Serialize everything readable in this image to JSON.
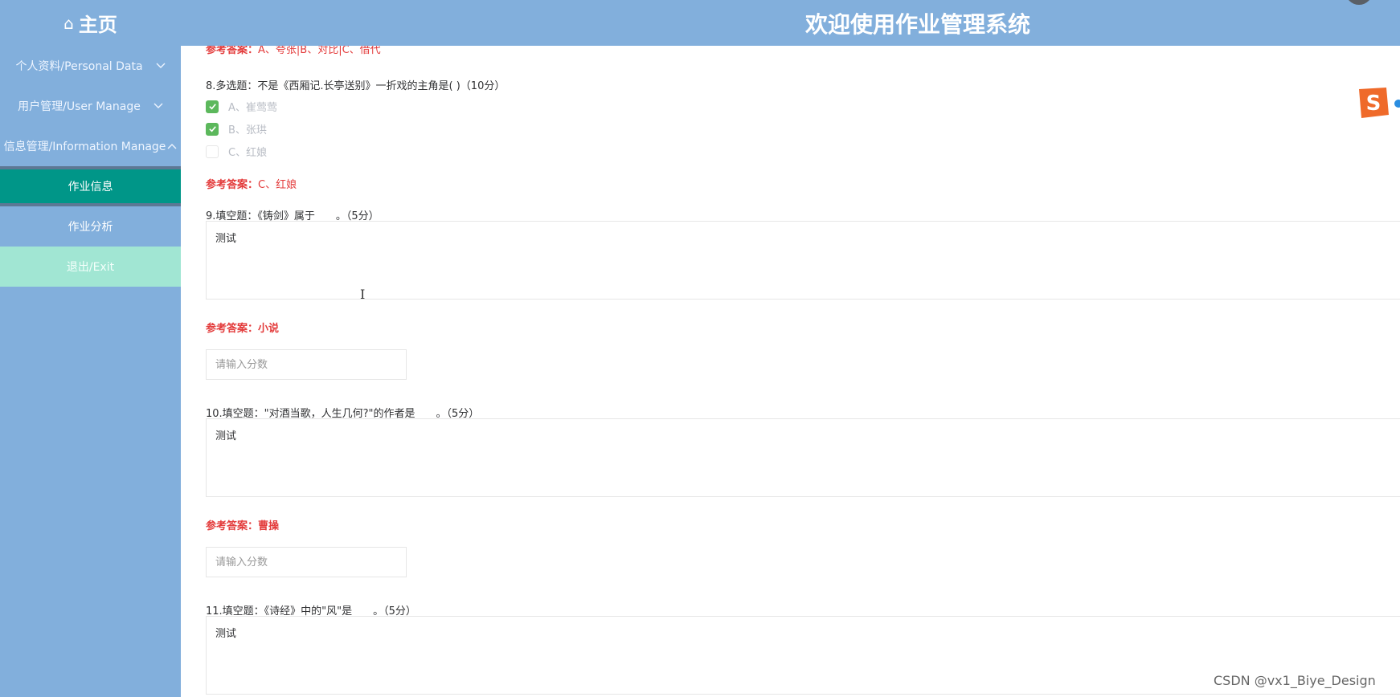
{
  "header": {
    "home_label": "主页",
    "site_title": "欢迎使用作业管理系统"
  },
  "sidebar": {
    "items": [
      {
        "label": "个人资料/Personal Data",
        "chevron": "chevron-down-icon"
      },
      {
        "label": "用户管理/User Manage",
        "chevron": "chevron-down-icon"
      },
      {
        "label": "信息管理/Information Manage",
        "chevron": "chevron-up-icon"
      }
    ],
    "subitems": [
      {
        "label": "作业信息",
        "active": true
      },
      {
        "label": "作业分析",
        "active": false
      }
    ],
    "exit_label": "退出/Exit"
  },
  "content": {
    "top_answer": {
      "prefix": "参考答案：",
      "value": "A、夸张|B、对比|C、借代"
    },
    "q8": {
      "text": "8.多选题：不是《西厢记.长亭送别》一折戏的主角是( )（10分）",
      "options": [
        {
          "label": "A、崔莺莺",
          "checked": true
        },
        {
          "label": "B、张珙",
          "checked": true
        },
        {
          "label": "C、红娘",
          "checked": false
        }
      ],
      "answer_prefix": "参考答案：",
      "answer_value": "C、红娘"
    },
    "q9": {
      "text": "9.填空题：《铸剑》属于____。（5分）",
      "response": "测试",
      "answer_prefix": "参考答案：",
      "answer_value": "小说",
      "score_placeholder": "请输入分数"
    },
    "q10": {
      "text": "10.填空题：\"对酒当歌，人生几何?\"的作者是____。（5分）",
      "response": "测试",
      "answer_prefix": "参考答案：",
      "answer_value": "曹操",
      "score_placeholder": "请输入分数"
    },
    "q11": {
      "text": "11.填空题：《诗经》中的\"风\"是____。（5分）",
      "response": "测试"
    }
  },
  "watermark": "CSDN @vx1_Biye_Design",
  "colors": {
    "header_bg": "#82afdc",
    "active_menu": "#009688",
    "exit_bg": "#a1e6d3",
    "answer_red": "#e33b3b",
    "check_green": "#5cb85c"
  }
}
